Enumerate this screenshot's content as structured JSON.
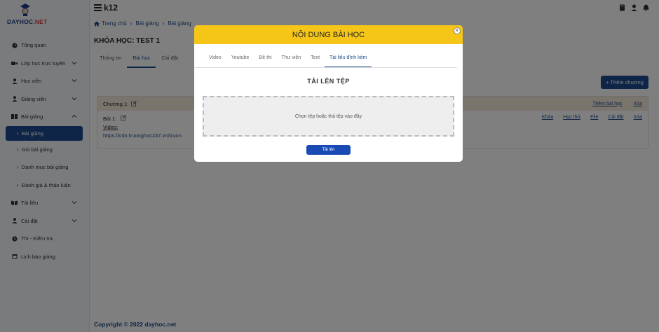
{
  "brand": {
    "name": "DAYHOC",
    "suffix": ".NET"
  },
  "topbar": {
    "title": "k12"
  },
  "sidebar": {
    "items": [
      {
        "label": "Tổng quan",
        "icon": "gauge-icon",
        "expandable": false
      },
      {
        "label": "Lớp học trực tuyến",
        "icon": "video-icon",
        "expandable": true
      },
      {
        "label": "Học viên",
        "icon": "user-icon",
        "expandable": true
      },
      {
        "label": "Giảng viên",
        "icon": "user-icon",
        "expandable": true
      },
      {
        "label": "Bài giảng",
        "icon": "book-icon",
        "expandable": true,
        "expanded": true
      }
    ],
    "subitems": [
      {
        "label": "Bài giảng",
        "active": true
      },
      {
        "label": "Gói bài giảng"
      },
      {
        "label": "Danh mục bài giảng"
      },
      {
        "label": "Đánh giá & thảo luận"
      }
    ],
    "items2": [
      {
        "label": "Tài liệu",
        "icon": "book-open-icon",
        "expandable": true
      },
      {
        "label": "Cài đặt",
        "icon": "user-icon",
        "expandable": true
      },
      {
        "label": "Thi - Kiểm tra",
        "icon": "clock-icon",
        "expandable": false
      },
      {
        "label": "Lịch báo giảng",
        "icon": "calendar-icon",
        "expandable": false
      }
    ]
  },
  "breadcrumb": [
    "Trang chủ",
    "Bài giảng",
    "Bài giảng"
  ],
  "page": {
    "title": "KHÓA HỌC: TEST 1",
    "tabs": [
      "Thông tin",
      "Bài học",
      "Cài đặt"
    ],
    "active_tab": "Bài học",
    "add_chapter_label": "+ Thêm chương"
  },
  "chapter": {
    "title": "Chương 1:",
    "actions": [
      "Thêm bài học",
      "Xóa"
    ],
    "lesson": {
      "title": "Bài 1:",
      "video_label": "Video:",
      "video_url": "https://cdn.truonghoc247.vn/truon",
      "actions": [
        "Khóa",
        "Học thử",
        "File",
        "Cài đặt",
        "Xóa"
      ]
    }
  },
  "footer": {
    "text": "Copyright © 2022 dayhoc.net"
  },
  "modal": {
    "title": "NỘI DUNG BÀI HỌC",
    "close": "×",
    "tabs": [
      "Video",
      "Youtube",
      "Đề thi",
      "Thư viện",
      "Text",
      "Tài liệu đính kèm"
    ],
    "active_tab": "Tài liệu đính kèm",
    "upload_title": "TẢI LÊN TỆP",
    "dropzone_text": "Chọn tệp hoặc thả tệp vào đây",
    "upload_button": "Tải lên"
  },
  "colors": {
    "primary": "#1e4b8f",
    "modal_header": "#f5c518",
    "upload_button": "#1a4bb5",
    "chapter_header": "#f4ead8"
  }
}
